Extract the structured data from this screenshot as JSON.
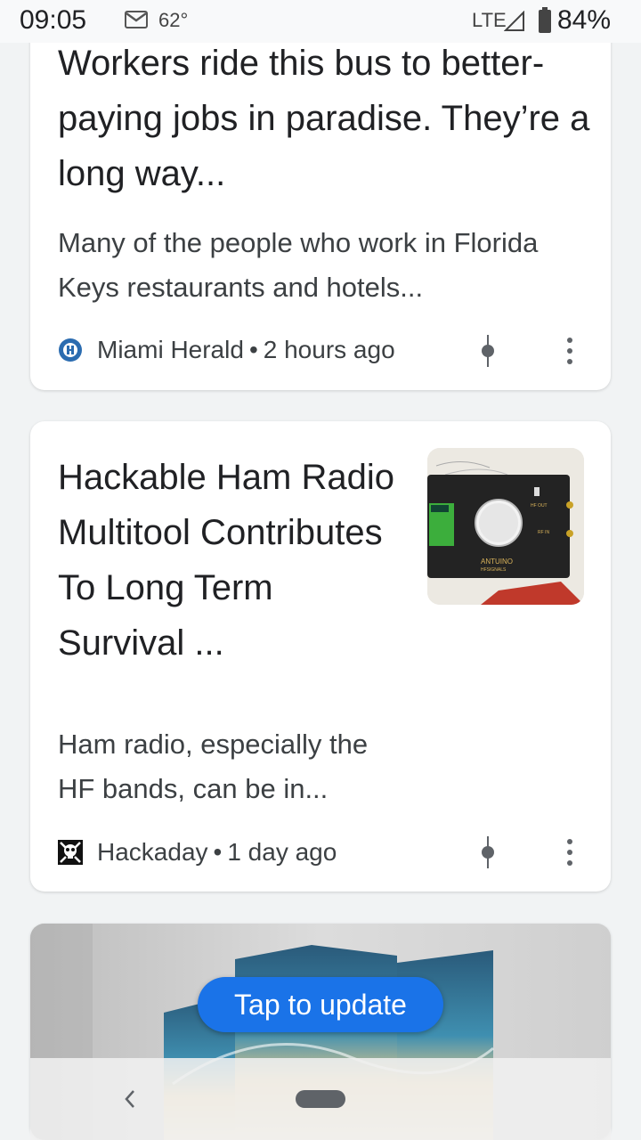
{
  "status_bar": {
    "time": "09:05",
    "temperature": "62°",
    "network": "LTE",
    "battery": "84%",
    "icons": [
      "gmail-icon",
      "signal-icon",
      "battery-icon"
    ]
  },
  "feed": {
    "cards": [
      {
        "headline": "Workers ride this bus to better-paying jobs in paradise. They’re a long way...",
        "snippet": "Many of the people who work in Florida Keys restaurants and hotels...",
        "source": "Miami Herald",
        "separator": "•",
        "time": "2 hours ago"
      },
      {
        "headline": "Hackable Ham Radio Multitool Contributes To Long Term Survival ...",
        "snippet": "Ham radio, especially the HF bands, can be in...",
        "source": "Hackaday",
        "separator": "•",
        "time": "1 day ago",
        "thumbnail_text": {
          "brand": "ANTUINO",
          "sub": "HFSIGNALS",
          "hf_out": "HF OUT",
          "rf_in": "RF IN"
        }
      }
    ]
  },
  "update_button": {
    "label": "Tap to update"
  },
  "colors": {
    "accent": "#1a73e8",
    "text_primary": "#202124",
    "text_secondary": "#3c4043",
    "background": "#f1f3f4"
  }
}
